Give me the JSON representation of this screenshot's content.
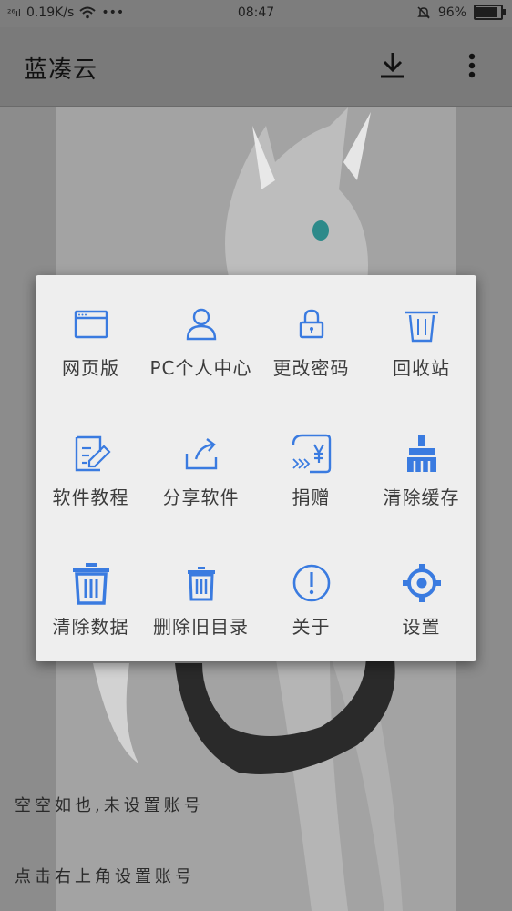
{
  "status_bar": {
    "signal": "²⁶ıl",
    "speed": "0.19K/s",
    "dots": "•••",
    "time": "08:47",
    "battery": "96%"
  },
  "app_bar": {
    "title": "蓝凑云",
    "download_icon": "download-icon",
    "more_icon": "more-vertical-icon"
  },
  "menu": {
    "items": [
      {
        "label": "网页版",
        "icon": "browser-window-icon"
      },
      {
        "label": "PC个人中心",
        "icon": "user-icon"
      },
      {
        "label": "更改密码",
        "icon": "lock-icon"
      },
      {
        "label": "回收站",
        "icon": "trash-icon"
      },
      {
        "label": "软件教程",
        "icon": "edit-document-icon"
      },
      {
        "label": "分享软件",
        "icon": "share-icon"
      },
      {
        "label": "捐赠",
        "icon": "donate-yen-icon"
      },
      {
        "label": "清除缓存",
        "icon": "brush-icon"
      },
      {
        "label": "清除数据",
        "icon": "trash-bold-icon"
      },
      {
        "label": "删除旧目录",
        "icon": "trash-small-icon"
      },
      {
        "label": "关于",
        "icon": "info-icon"
      },
      {
        "label": "设置",
        "icon": "gear-icon"
      }
    ],
    "accent": "#3a7be0"
  },
  "background": {
    "line1": "空空如也,未设置账号",
    "line2": "点击右上角设置账号"
  }
}
